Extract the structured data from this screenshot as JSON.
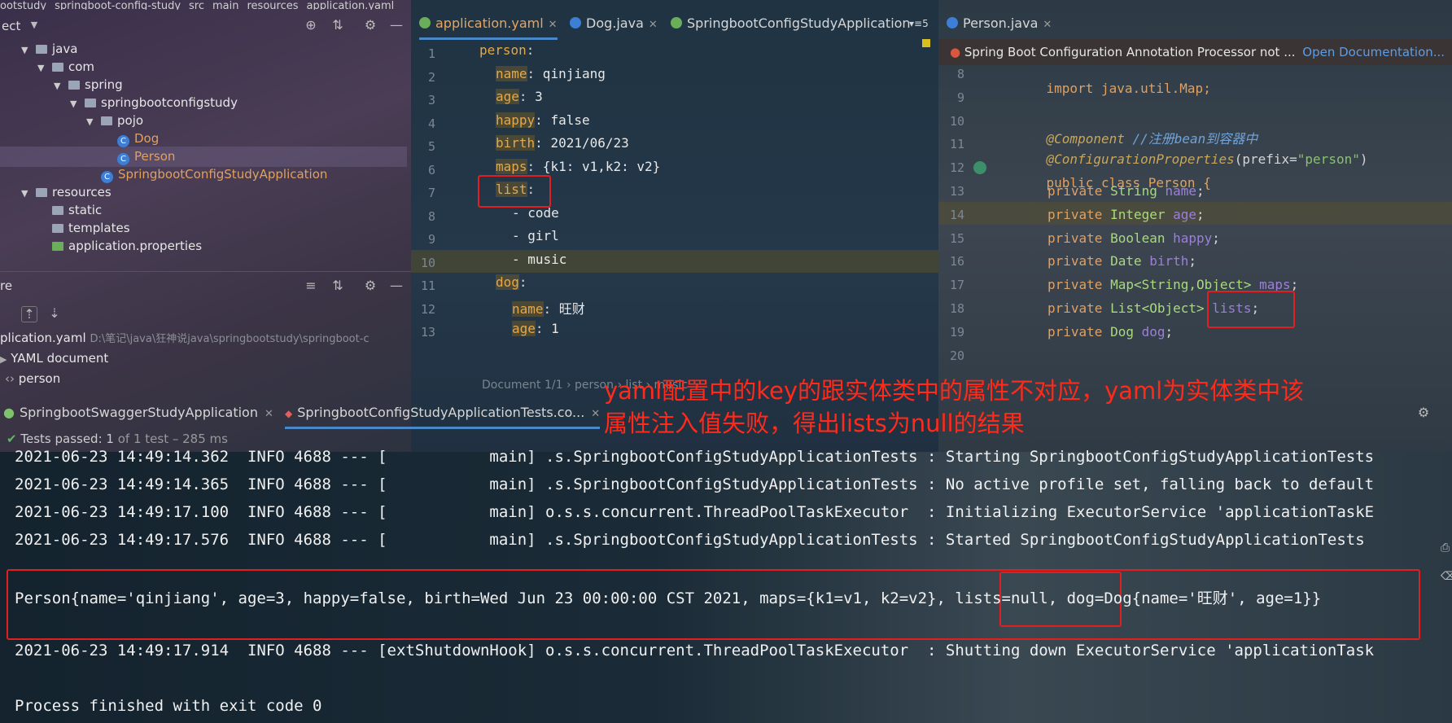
{
  "top_breadcrumb": [
    "ootstudy",
    "springboot-config-study",
    "src",
    "main",
    "resources",
    "application.yaml"
  ],
  "project_panel": {
    "title": "ect",
    "tree": [
      {
        "label": "java",
        "type": "folder",
        "depth": 1,
        "expanded": true
      },
      {
        "label": "com",
        "type": "folder",
        "depth": 2,
        "expanded": true
      },
      {
        "label": "spring",
        "type": "folder",
        "depth": 3,
        "expanded": true
      },
      {
        "label": "springbootconfigstudy",
        "type": "folder",
        "depth": 4,
        "expanded": true
      },
      {
        "label": "pojo",
        "type": "folder",
        "depth": 5,
        "expanded": true
      },
      {
        "label": "Dog",
        "type": "class",
        "depth": 6
      },
      {
        "label": "Person",
        "type": "class",
        "depth": 6,
        "selected": true
      },
      {
        "label": "SpringbootConfigStudyApplication",
        "type": "class",
        "depth": 5
      },
      {
        "label": "resources",
        "type": "folder",
        "depth": 1,
        "expanded": true
      },
      {
        "label": "static",
        "type": "folder",
        "depth": 2
      },
      {
        "label": "templates",
        "type": "folder",
        "depth": 2
      },
      {
        "label": "application.properties",
        "type": "file",
        "depth": 2
      }
    ]
  },
  "structure_panel": {
    "title": "re",
    "rows": [
      {
        "label": "plication.yaml",
        "path": "D:\\笔记\\java\\狂神说java\\springbootstudy\\springboot-c"
      },
      {
        "label": "YAML document",
        "path": ""
      },
      {
        "label": "person",
        "path": ""
      }
    ]
  },
  "editor_tabs": [
    {
      "label": "application.yaml",
      "active": true
    },
    {
      "label": "Dog.java",
      "active": false
    },
    {
      "label": "SpringbootConfigStudyApplication",
      "active": false
    },
    {
      "label": "5",
      "active": false
    },
    {
      "label": "Person.java",
      "active": false
    }
  ],
  "yaml_editor": {
    "line_numbers": [
      "1",
      "2",
      "3",
      "4",
      "5",
      "6",
      "7",
      "8",
      "9",
      "10",
      "11",
      "12",
      "13"
    ],
    "lines": [
      {
        "key": "person",
        "value": ""
      },
      {
        "key": "name",
        "value": " qinjiang"
      },
      {
        "key": "age",
        "value": " 3"
      },
      {
        "key": "happy",
        "value": " false"
      },
      {
        "key": "birth",
        "value": " 2021/06/23"
      },
      {
        "key": "maps",
        "value": " {k1: v1,k2: v2}"
      },
      {
        "key": "list",
        "value": ""
      },
      {
        "key": "",
        "value": "- code"
      },
      {
        "key": "",
        "value": "- girl"
      },
      {
        "key": "",
        "value": "- music"
      },
      {
        "key": "dog",
        "value": ""
      },
      {
        "key": "name",
        "value": " 旺财"
      },
      {
        "key": "age",
        "value": " 1"
      }
    ],
    "status_breadcrumb": "Document 1/1  ›  person  ›  list  ›  music"
  },
  "java_editor": {
    "warning": "Spring Boot Configuration Annotation Processor not ...",
    "warning_link": "Open Documentation...",
    "line_numbers": [
      "8",
      "9",
      "10",
      "11",
      "12",
      "13",
      "14",
      "15",
      "16",
      "17",
      "18",
      "19",
      "20"
    ],
    "lines": {
      "l8": "import java.util.Map;",
      "l10_ann": "@Component",
      "l10_com": " //注册bean到容器中",
      "l11_ann": "@ConfigurationProperties",
      "l11_rest": "(prefix=",
      "l11_str": "\"person\"",
      "l11_end": ")",
      "l12": "public class Person {",
      "fields": [
        {
          "type": "String",
          "name": "name"
        },
        {
          "type": "Integer",
          "name": "age"
        },
        {
          "type": "Boolean",
          "name": "happy"
        },
        {
          "type": "Date",
          "name": "birth"
        },
        {
          "type": "Map<String,Object>",
          "name": "maps"
        },
        {
          "type": "List<Object>",
          "name": "lists"
        },
        {
          "type": "Dog",
          "name": "dog"
        }
      ],
      "kw_private": "private"
    }
  },
  "annotation": {
    "line1": "yaml配置中的key的跟实体类中的属性不对应，yaml为实体类中该",
    "line2": "属性注入值失败，得出lists为null的结果"
  },
  "run_tabs": [
    {
      "label": "SpringbootSwaggerStudyApplication"
    },
    {
      "label": "SpringbootConfigStudyApplicationTests.co..."
    }
  ],
  "tests_status": {
    "passed": "Tests passed:",
    "count": "1",
    "detail": "of 1 test – 285 ms"
  },
  "console": {
    "lines": [
      "2021-06-23 14:49:14.362  INFO 4688 --- [           main] .s.SpringbootConfigStudyApplicationTests : Starting SpringbootConfigStudyApplicationTests",
      "2021-06-23 14:49:14.365  INFO 4688 --- [           main] .s.SpringbootConfigStudyApplicationTests : No active profile set, falling back to default",
      "2021-06-23 14:49:17.100  INFO 4688 --- [           main] o.s.s.concurrent.ThreadPoolTaskExecutor  : Initializing ExecutorService 'applicationTaskE",
      "2021-06-23 14:49:17.576  INFO 4688 --- [           main] .s.SpringbootConfigStudyApplicationTests : Started SpringbootConfigStudyApplicationTests"
    ],
    "result": "Person{name='qinjiang', age=3, happy=false, birth=Wed Jun 23 00:00:00 CST 2021, maps={k1=v1, k2=v2}, lists=null, dog=Dog{name='旺财', age=1}}",
    "shutdown": "2021-06-23 14:49:17.914  INFO 4688 --- [extShutdownHook] o.s.s.concurrent.ThreadPoolTaskExecutor  : Shutting down ExecutorService 'applicationTask",
    "exit": "Process finished with exit code 0"
  },
  "colors": {
    "accent_red": "#e02020",
    "yaml_key": "#e4a84a",
    "java_keyword": "#e0a060",
    "java_field": "#9c7fd8"
  }
}
